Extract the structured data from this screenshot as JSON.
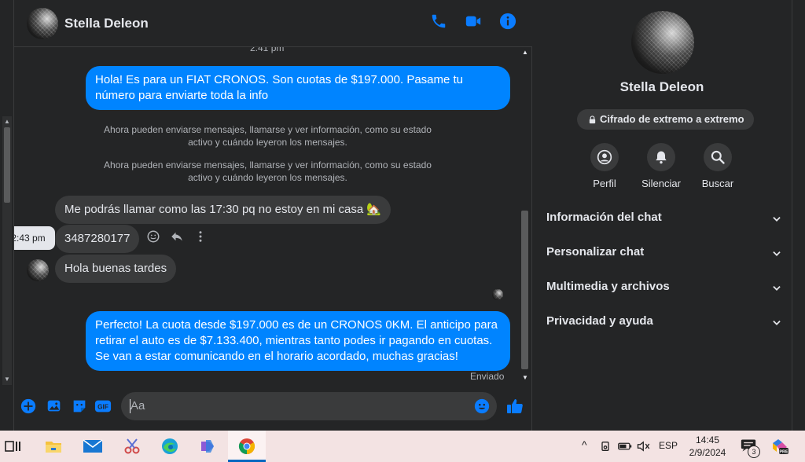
{
  "contact": {
    "name": "Stella Deleon"
  },
  "chat": {
    "top_time": "2:41 pm",
    "messages": {
      "m1": "Hola! Es para un FIAT CRONOS. Son cuotas de $197.000. Pasame tu número para enviarte toda la info",
      "sys1": "Ahora pueden enviarse mensajes, llamarse y ver información, como su estado activo y cuándo leyeron los mensajes.",
      "sys2": "Ahora pueden enviarse mensajes, llamarse y ver información, como su estado activo y cuándo leyeron los mensajes.",
      "m2": "Me podrás llamar como las 17:30 pq no estoy en mi casa 🏡",
      "m3": "3487280177",
      "m4": "Hola buenas tardes",
      "m5": "Perfecto! La cuota desde $197.000 es de un CRONOS 0KM. El anticipo para retirar el auto es de $7.133.400, mientras tanto podes ir pagando en cuotas. Se van a estar comunicando en el horario acordado, muchas gracias!"
    },
    "hover_time": "2:43 pm",
    "sent_status": "Enviado"
  },
  "composer": {
    "placeholder": "Aa"
  },
  "info_panel": {
    "name": "Stella Deleon",
    "encryption": "Cifrado de extremo a extremo",
    "actions": {
      "profile": "Perfil",
      "mute": "Silenciar",
      "search": "Buscar"
    },
    "sections": {
      "chat_info": "Información del chat",
      "customize": "Personalizar chat",
      "media": "Multimedia y archivos",
      "privacy": "Privacidad y ayuda"
    }
  },
  "taskbar": {
    "language": "ESP",
    "time": "14:45",
    "date": "2/9/2024",
    "notification_count": "3"
  },
  "colors": {
    "accent": "#0084ff",
    "icon_blue": "#0a7cff",
    "bg": "#242526",
    "bubble_in": "#3a3b3c"
  }
}
